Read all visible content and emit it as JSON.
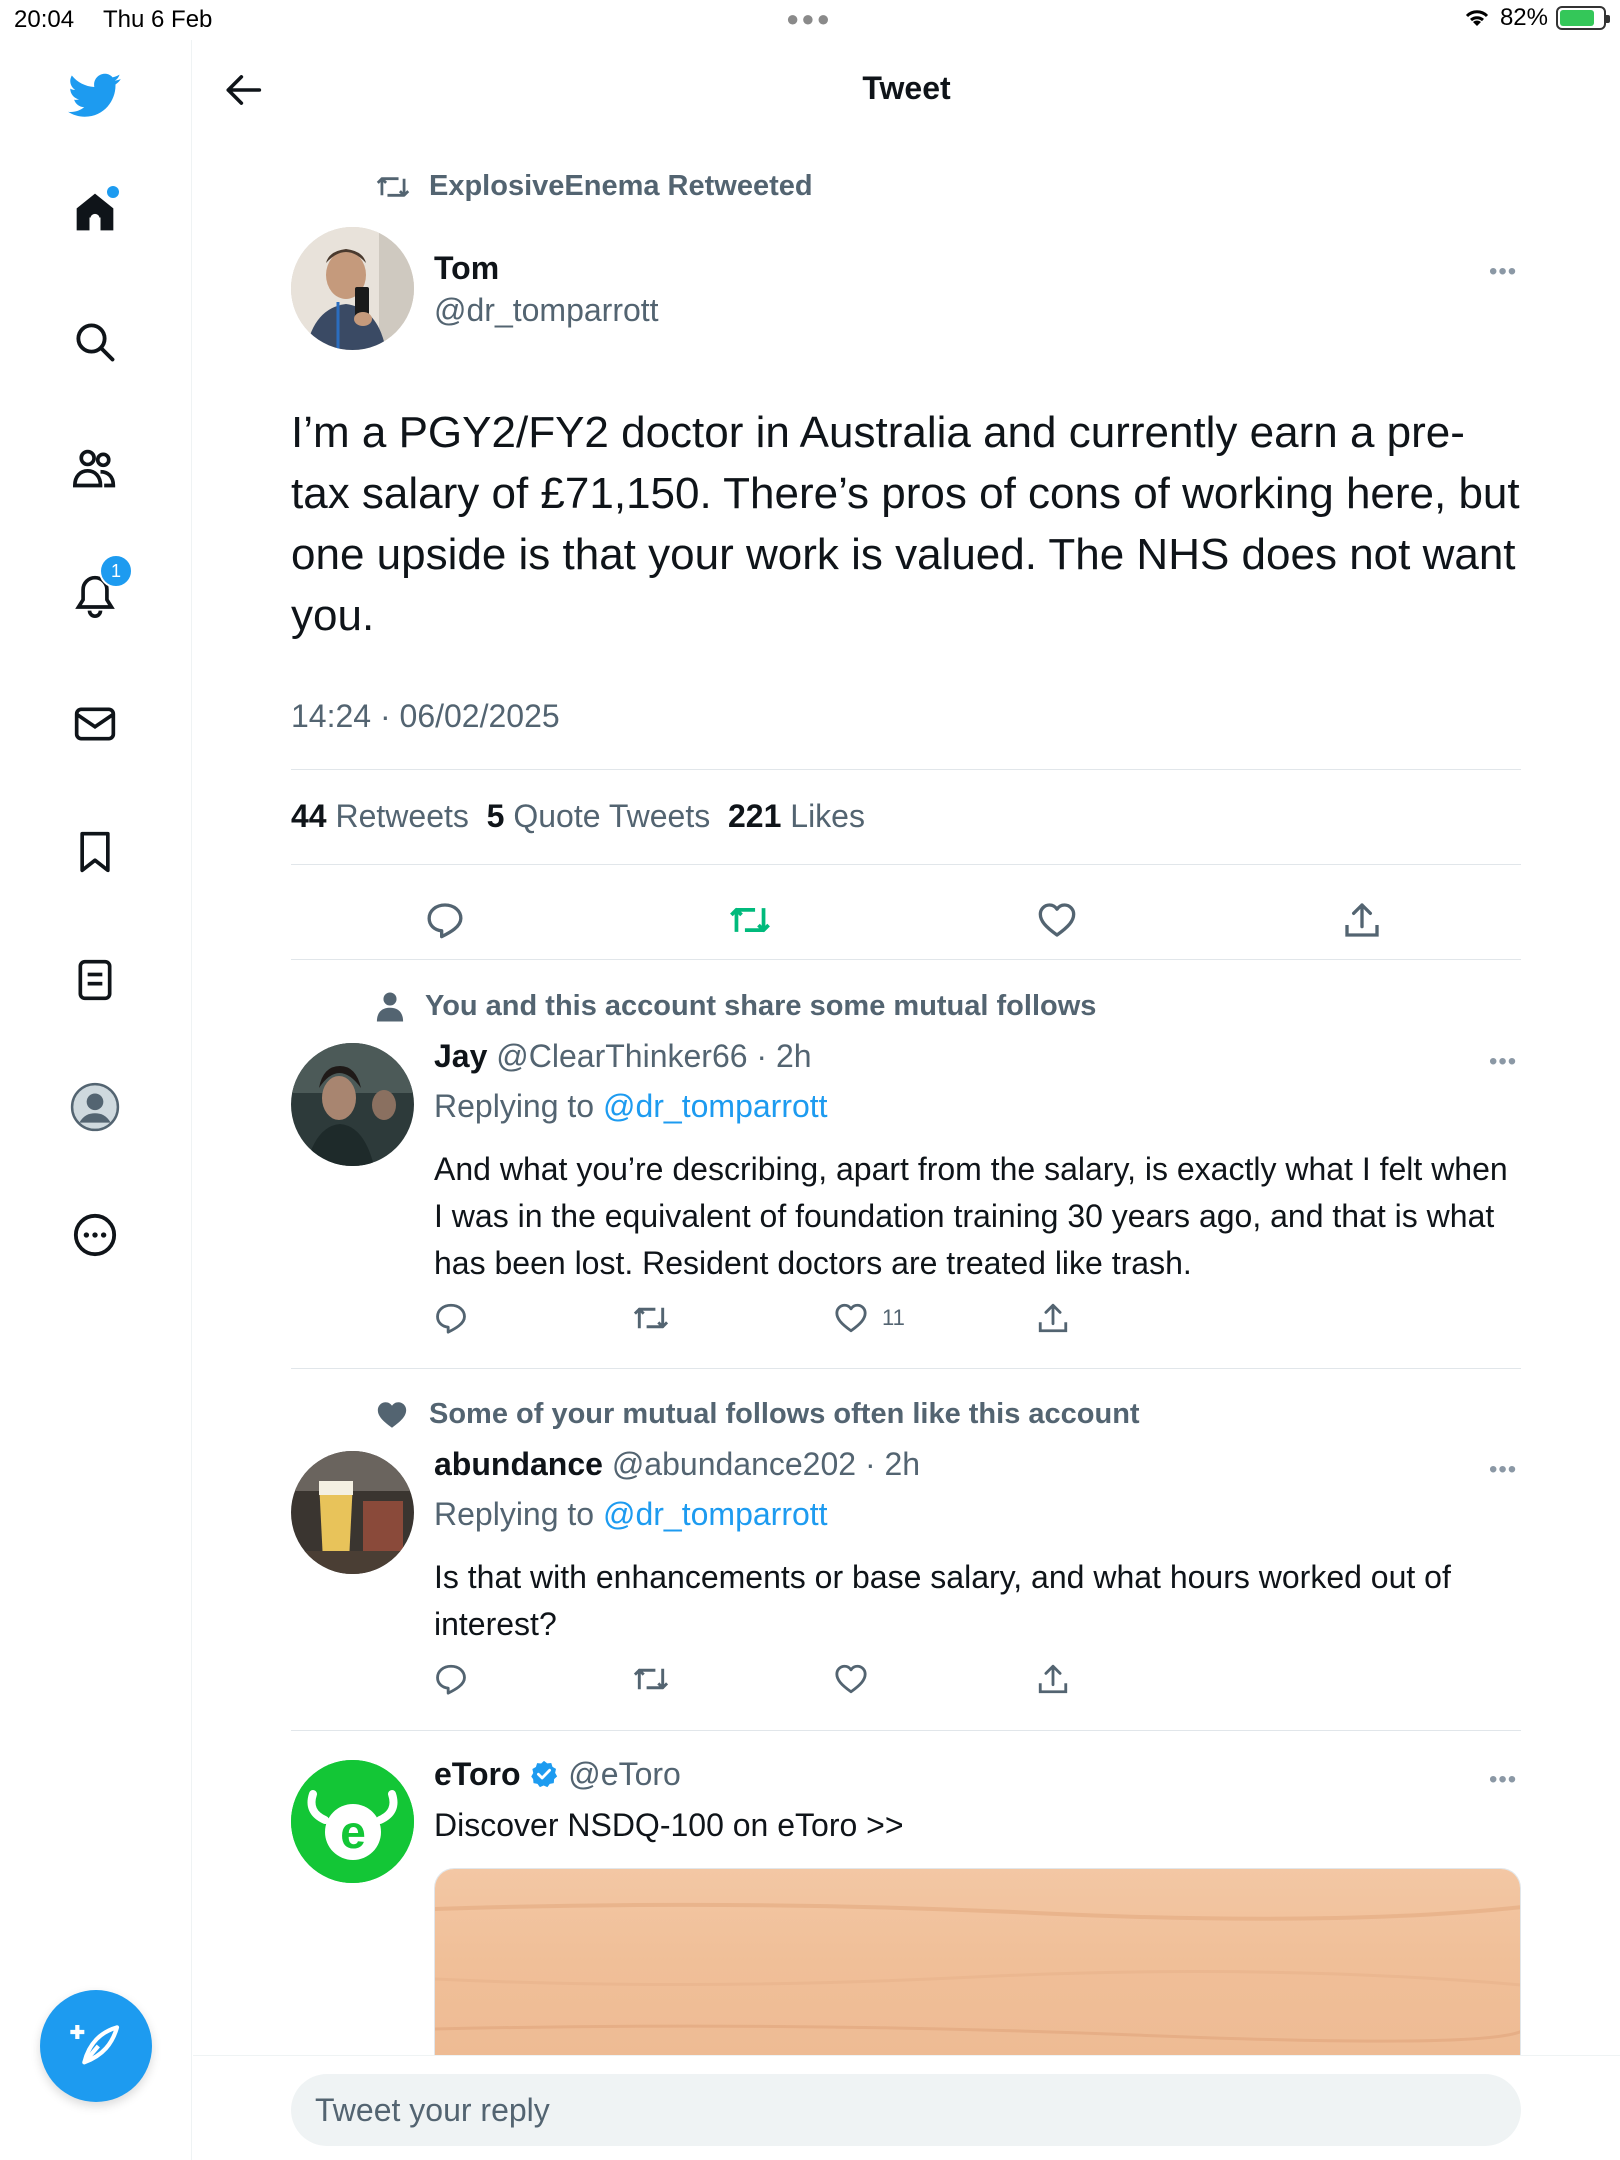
{
  "status_bar": {
    "time": "20:04",
    "date": "Thu 6 Feb",
    "battery": "82%",
    "battery_level": 0.82
  },
  "header": {
    "title": "Tweet"
  },
  "rail": {
    "notifications_badge": "1"
  },
  "tweet": {
    "retweeted_by": "ExplosiveEnema Retweeted",
    "author_name": "Tom",
    "author_handle": "@dr_tomparrott",
    "text": "I’m a PGY2/FY2 doctor in Australia and currently earn a pre-tax salary of £71,150. There’s pros of cons of working here, but one upside is that your work is valued. The NHS does not want you.",
    "timestamp": "14:24 · 06/02/2025",
    "retweets_count": "44",
    "retweets_label": "Retweets",
    "quotes_count": "5",
    "quotes_label": "Quote Tweets",
    "likes_count": "221",
    "likes_label": "Likes"
  },
  "replies": [
    {
      "social_context": "You and this account share some mutual follows",
      "name": "Jay",
      "handle_time": "@ClearThinker66 · 2h",
      "replying_prefix": "Replying to",
      "replying_to": "@dr_tomparrott",
      "text": "And what you’re describing, apart from the salary, is exactly what I felt when I was in the equivalent of foundation training 30 years ago, and that is what has been lost. Resident doctors are treated like trash.",
      "likes": "11"
    },
    {
      "social_context": "Some of your mutual follows often like this account",
      "name": "abundance",
      "handle_time": "@abundance202 · 2h",
      "replying_prefix": "Replying to",
      "replying_to": "@dr_tomparrott",
      "text": "Is that with enhancements or base salary, and what hours worked out of interest?",
      "likes": ""
    }
  ],
  "ad": {
    "name": "eToro",
    "handle": "@eToro",
    "text": "Discover NSDQ-100 on eToro >>"
  },
  "reply_bar": {
    "placeholder": "Tweet your reply"
  },
  "colors": {
    "accent": "#1d9bf0",
    "retweet_green": "#00ba7c",
    "secondary_text": "#536471"
  }
}
